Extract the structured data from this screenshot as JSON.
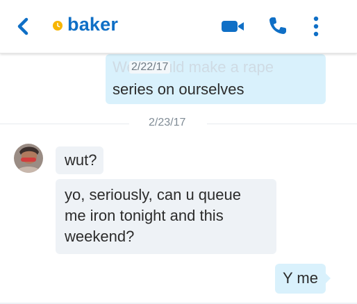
{
  "header": {
    "contact_name": "baker",
    "icons": [
      "back-icon",
      "status-away-icon",
      "video-call-icon",
      "phone-icon",
      "more-options-icon"
    ],
    "accent_color": "#0f6fc6",
    "status_color": "#f7b500"
  },
  "messages": {
    "top_partial_text": "We should make a rape",
    "top_text": "series on ourselves",
    "floating_date": "2/22/17",
    "separator_date": "2/23/17",
    "in_1": "wut?",
    "in_2_line1": "yo, seriously, can u queue",
    "in_2_line2": "me iron tonight and this",
    "in_2_line3": "weekend?",
    "out_1": "Y me"
  }
}
